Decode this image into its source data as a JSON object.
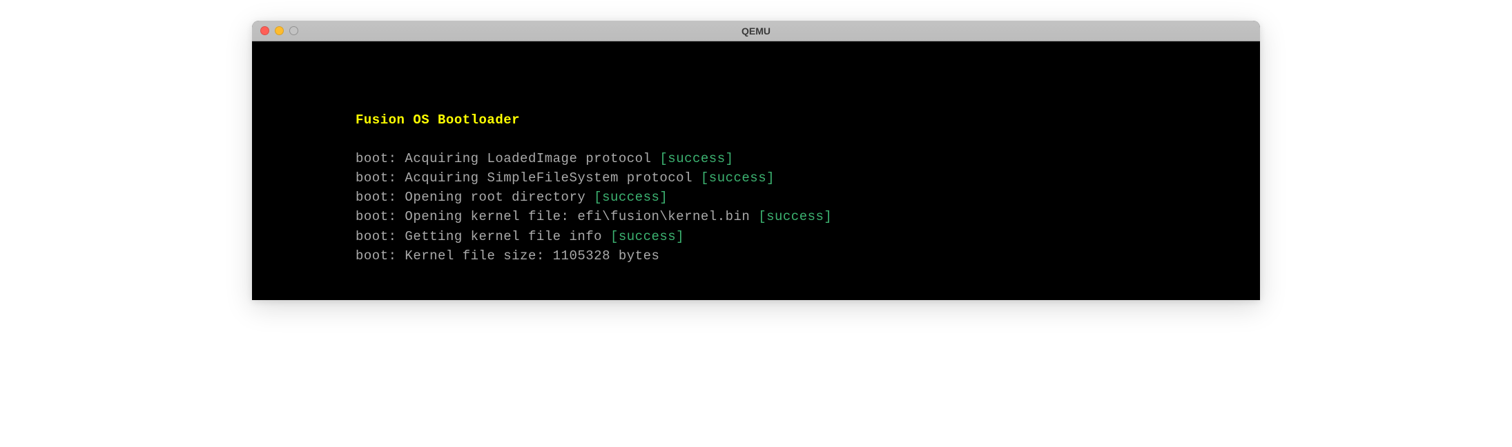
{
  "window": {
    "title": "QEMU"
  },
  "terminal": {
    "header": "Fusion OS Bootloader",
    "lines": [
      {
        "prefix": "boot: ",
        "message": "Acquiring LoadedImage protocol ",
        "status": "[success]"
      },
      {
        "prefix": "boot: ",
        "message": "Acquiring SimpleFileSystem protocol ",
        "status": "[success]"
      },
      {
        "prefix": "boot: ",
        "message": "Opening root directory ",
        "status": "[success]"
      },
      {
        "prefix": "boot: ",
        "message": "Opening kernel file: efi\\fusion\\kernel.bin ",
        "status": "[success]"
      },
      {
        "prefix": "boot: ",
        "message": "Getting kernel file info ",
        "status": "[success]"
      },
      {
        "prefix": "boot: ",
        "message": "Kernel file size: 1105328 bytes",
        "status": ""
      }
    ]
  }
}
